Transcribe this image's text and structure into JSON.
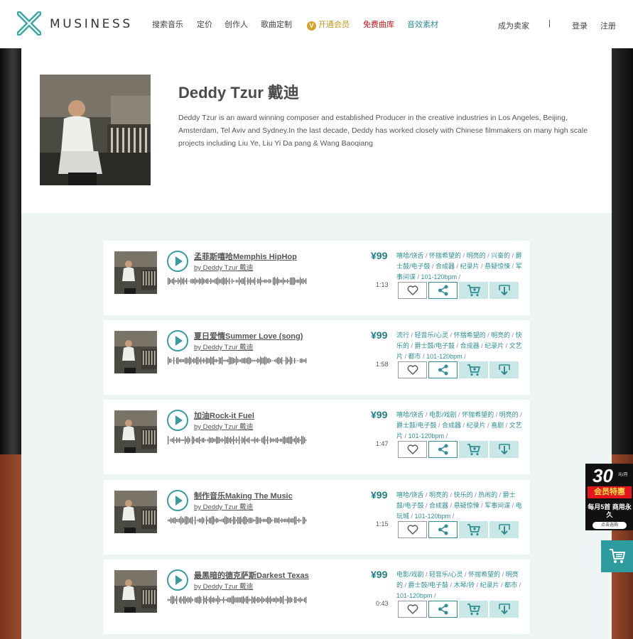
{
  "header": {
    "logo_text": "MUSINESS",
    "nav": {
      "search": "搜索音乐",
      "pricing": "定价",
      "creators": "创作人",
      "custom": "歌曲定制",
      "vip_badge": "V",
      "vip": "开通会员",
      "free": "免费曲库",
      "sfx": "音效素材",
      "become_seller": "成为卖家",
      "divider": "|",
      "login": "登录",
      "register": "注册"
    },
    "colors": {
      "vip": "#d4a12a",
      "free": "#c0141a",
      "sfx": "#2f8e92"
    }
  },
  "artist": {
    "name": "Deddy Tzur 戴迪",
    "bio": "Deddy Tzur is an award winning composer and established Producer in the creative industries in Los Angeles, Beijing, Amsterdam, Tel Aviv and Sydney.In the last decade, Deddy has worked closely with Chinese filmmakers on many high scale projects including Liu Ye, Liu Yi Da pang & Wang Baoqiang"
  },
  "tracks": [
    {
      "title": "孟菲斯嘻哈Memphis HipHop",
      "artist": "by Deddy Tzur 戴迪",
      "price": "¥99",
      "duration": "1:13",
      "tags": [
        "嘻哈/饶舌",
        "怀揣希望的",
        "明亮的",
        "兴奋的",
        "爵士鼓/电子鼓",
        "合成器",
        "纪录片",
        "悬疑惊悚",
        "军事间谍",
        "101-120bpm"
      ]
    },
    {
      "title": "夏日爱情Summer Love (song)",
      "artist": "by Deddy Tzur 戴迪",
      "price": "¥99",
      "duration": "1:58",
      "tags": [
        "流行",
        "轻音乐/心灵",
        "怀揣希望的",
        "明亮的",
        "快乐的",
        "爵士鼓/电子鼓",
        "合成器",
        "纪录片",
        "文艺片",
        "都市",
        "101-120bpm"
      ]
    },
    {
      "title": "加油Rock-it Fuel",
      "artist": "by Deddy Tzur 戴迪",
      "price": "¥99",
      "duration": "1:47",
      "tags": [
        "嘻哈/饶舌",
        "电影/戏剧",
        "怀揣希望的",
        "明亮的",
        "爵士鼓/电子鼓",
        "合成器",
        "纪录片",
        "喜剧",
        "文艺片",
        "101-120bpm"
      ]
    },
    {
      "title": "制作音乐Making The Music",
      "artist": "by Deddy Tzur 戴迪",
      "price": "¥99",
      "duration": "1:15",
      "tags": [
        "嘻哈/饶舌",
        "明亮的",
        "快乐的",
        "热闹的",
        "爵士鼓/电子鼓",
        "合成器",
        "悬疑惊悚",
        "军事间谍",
        "电玩城",
        "101-120bpm"
      ]
    },
    {
      "title": "最黑暗的德克萨斯Darkest Texas",
      "artist": "by Deddy Tzur 戴迪",
      "price": "¥99",
      "duration": "0:43",
      "tags": [
        "电影/戏剧",
        "轻音乐/心灵",
        "怀揣希望的",
        "明亮的",
        "爵士鼓/电子鼓",
        "木琴/铃",
        "纪录片",
        "都市",
        "101-120bpm"
      ]
    }
  ],
  "promo": {
    "number": "30",
    "unit": "元/月",
    "title": "会员特惠",
    "subtitle": "每月5首 商用永久",
    "cta": "点击选购"
  },
  "icons": {
    "logo": "musiness-x-logo-icon",
    "play": "play-icon",
    "like": "heart-icon",
    "share": "share-icon",
    "cart": "cart-icon",
    "download": "download-icon"
  }
}
